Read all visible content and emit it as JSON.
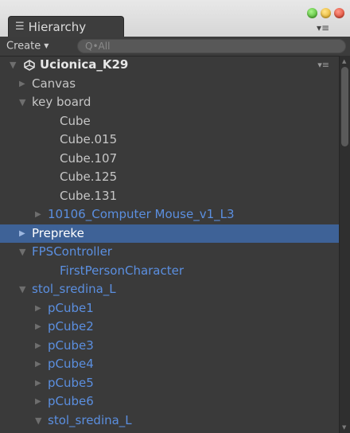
{
  "window": {
    "tab_title": "Hierarchy",
    "tab_icon": "list-icon",
    "traffic_lights": [
      "green",
      "yellow",
      "red"
    ]
  },
  "toolbar": {
    "create_label": "Create",
    "search_placeholder": "Q•All"
  },
  "scene": {
    "name": "Ucionica_K29"
  },
  "rows": [
    {
      "label": "Canvas",
      "depth": 1,
      "arrow": "closed",
      "color": "gray"
    },
    {
      "label": "key board",
      "depth": 1,
      "arrow": "open",
      "color": "gray"
    },
    {
      "label": "Cube",
      "depth": 2,
      "arrow": "none",
      "color": "gray"
    },
    {
      "label": "Cube.015",
      "depth": 2,
      "arrow": "none",
      "color": "gray"
    },
    {
      "label": "Cube.107",
      "depth": 2,
      "arrow": "none",
      "color": "gray"
    },
    {
      "label": "Cube.125",
      "depth": 2,
      "arrow": "none",
      "color": "gray"
    },
    {
      "label": "Cube.131",
      "depth": 2,
      "arrow": "none",
      "color": "gray"
    },
    {
      "label": "10106_Computer Mouse_v1_L3",
      "depth": 2,
      "arrow": "closed",
      "color": "blue"
    },
    {
      "label": "Prepreke",
      "depth": 1,
      "arrow": "closed",
      "color": "white",
      "selected": true
    },
    {
      "label": "FPSController",
      "depth": 1,
      "arrow": "open",
      "color": "blue"
    },
    {
      "label": "FirstPersonCharacter",
      "depth": 2,
      "arrow": "none",
      "color": "blue"
    },
    {
      "label": "stol_sredina_L",
      "depth": 1,
      "arrow": "open",
      "color": "blue"
    },
    {
      "label": "pCube1",
      "depth": 2,
      "arrow": "closed",
      "color": "blue"
    },
    {
      "label": "pCube2",
      "depth": 2,
      "arrow": "closed",
      "color": "blue"
    },
    {
      "label": "pCube3",
      "depth": 2,
      "arrow": "closed",
      "color": "blue"
    },
    {
      "label": "pCube4",
      "depth": 2,
      "arrow": "closed",
      "color": "blue"
    },
    {
      "label": "pCube5",
      "depth": 2,
      "arrow": "closed",
      "color": "blue"
    },
    {
      "label": "pCube6",
      "depth": 2,
      "arrow": "closed",
      "color": "blue"
    },
    {
      "label": "stol_sredina_L",
      "depth": 2,
      "arrow": "open",
      "color": "blue"
    }
  ],
  "colors": {
    "background": "#3a3a3a",
    "selection": "#3e6297",
    "prefab_blue": "#5b8fe0",
    "text_gray": "#c6c6c6"
  }
}
